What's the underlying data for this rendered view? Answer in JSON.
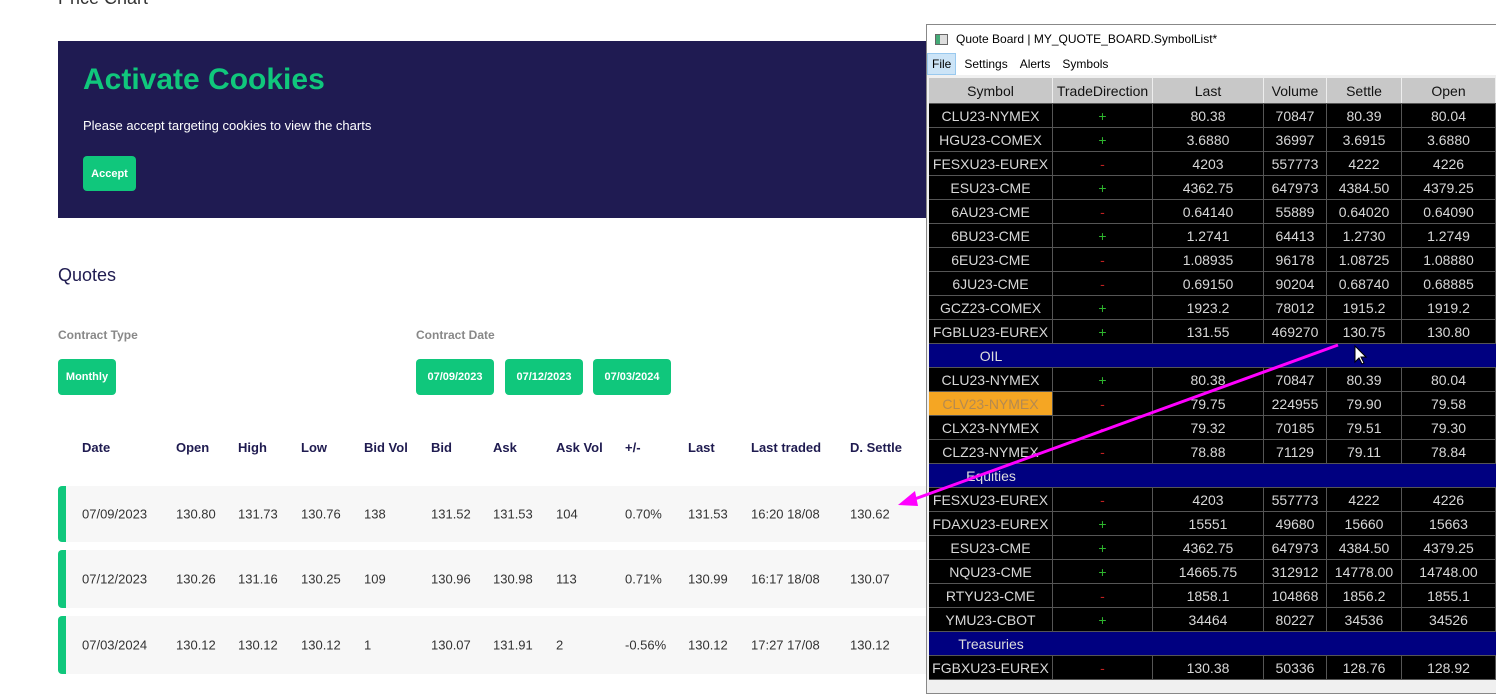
{
  "page": {
    "price_chart_title": "Price Chart",
    "cookie": {
      "title": "Activate Cookies",
      "message": "Please accept targeting cookies to view the charts",
      "accept": "Accept"
    },
    "quotes_title": "Quotes",
    "contract_type_label": "Contract Type",
    "contract_type": "Monthly",
    "contract_date_label": "Contract Date",
    "contract_dates": [
      "07/09/2023",
      "07/12/2023",
      "07/03/2024"
    ],
    "columns": [
      "Date",
      "Open",
      "High",
      "Low",
      "Bid Vol",
      "Bid",
      "Ask",
      "Ask Vol",
      "+/-",
      "Last",
      "Last traded",
      "D. Settle"
    ],
    "rows": [
      [
        "07/09/2023",
        "130.80",
        "131.73",
        "130.76",
        "138",
        "131.52",
        "131.53",
        "104",
        "0.70%",
        "131.53",
        "16:20 18/08",
        "130.62"
      ],
      [
        "07/12/2023",
        "130.26",
        "131.16",
        "130.25",
        "109",
        "130.96",
        "130.98",
        "113",
        "0.71%",
        "130.99",
        "16:17 18/08",
        "130.07"
      ],
      [
        "07/03/2024",
        "130.12",
        "130.12",
        "130.12",
        "1",
        "130.07",
        "131.91",
        "2",
        "-0.56%",
        "130.12",
        "17:27 17/08",
        "130.12"
      ]
    ]
  },
  "window": {
    "title": "Quote Board | MY_QUOTE_BOARD.SymbolList*",
    "menu": [
      "File",
      "Settings",
      "Alerts",
      "Symbols"
    ],
    "columns": [
      "Symbol",
      "TradeDirection",
      "Last",
      "Volume",
      "Settle",
      "Open"
    ],
    "rows": [
      [
        "CLU23-NYMEX",
        "+",
        "80.38",
        "70847",
        "80.39",
        "80.04"
      ],
      [
        "HGU23-COMEX",
        "+",
        "3.6880",
        "36997",
        "3.6915",
        "3.6880"
      ],
      [
        "FESXU23-EUREX",
        "-",
        "4203",
        "557773",
        "4222",
        "4226"
      ],
      [
        "ESU23-CME",
        "+",
        "4362.75",
        "647973",
        "4384.50",
        "4379.25"
      ],
      [
        "6AU23-CME",
        "-",
        "0.64140",
        "55889",
        "0.64020",
        "0.64090"
      ],
      [
        "6BU23-CME",
        "+",
        "1.2741",
        "64413",
        "1.2730",
        "1.2749"
      ],
      [
        "6EU23-CME",
        "-",
        "1.08935",
        "96178",
        "1.08725",
        "1.08880"
      ],
      [
        "6JU23-CME",
        "-",
        "0.69150",
        "90204",
        "0.68740",
        "0.68885"
      ],
      [
        "GCZ23-COMEX",
        "+",
        "1923.2",
        "78012",
        "1915.2",
        "1919.2"
      ],
      [
        "FGBLU23-EUREX",
        "+",
        "131.55",
        "469270",
        "130.75",
        "130.80"
      ],
      {
        "section": "OIL"
      },
      [
        "CLU23-NYMEX",
        "+",
        "80.38",
        "70847",
        "80.39",
        "80.04"
      ],
      [
        "CLV23-NYMEX",
        "-",
        "79.75",
        "224955",
        "79.90",
        "79.58"
      ],
      [
        "CLX23-NYMEX",
        "-",
        "79.32",
        "70185",
        "79.51",
        "79.30"
      ],
      [
        "CLZ23-NYMEX",
        "-",
        "78.88",
        "71129",
        "79.11",
        "78.84"
      ],
      {
        "section": "Equities"
      },
      [
        "FESXU23-EUREX",
        "-",
        "4203",
        "557773",
        "4222",
        "4226"
      ],
      [
        "FDAXU23-EUREX",
        "+",
        "15551",
        "49680",
        "15660",
        "15663"
      ],
      [
        "ESU23-CME",
        "+",
        "4362.75",
        "647973",
        "4384.50",
        "4379.25"
      ],
      [
        "NQU23-CME",
        "+",
        "14665.75",
        "312912",
        "14778.00",
        "14748.00"
      ],
      [
        "RTYU23-CME",
        "-",
        "1858.1",
        "104868",
        "1856.2",
        "1855.1"
      ],
      [
        "YMU23-CBOT",
        "+",
        "34464",
        "80227",
        "34536",
        "34526"
      ],
      {
        "section": "Treasuries"
      },
      [
        "FGBXU23-EUREX",
        "-",
        "130.38",
        "50336",
        "128.76",
        "128.92"
      ]
    ],
    "highlighted_symbol": "CLV23-NYMEX"
  },
  "colors": {
    "accent": "#10c77c",
    "banner": "#1f1b52",
    "section": "#000080",
    "annotation": "#ff00ff"
  }
}
